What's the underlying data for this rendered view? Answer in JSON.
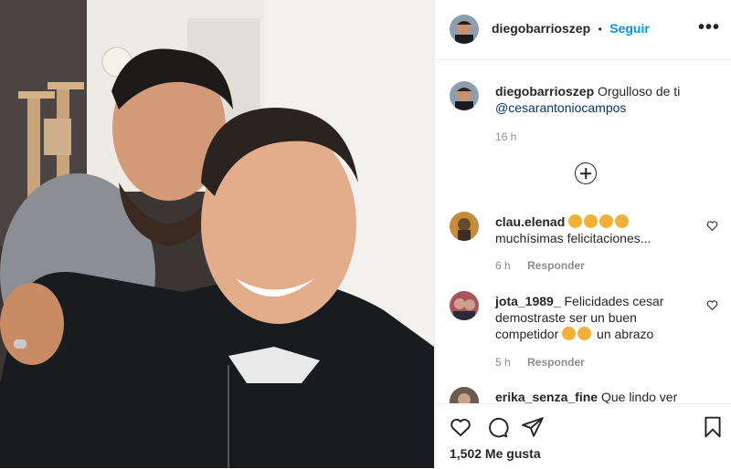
{
  "post": {
    "username": "diegobarrioszep",
    "follow_label": "Seguir",
    "dot": "•",
    "more": "•••"
  },
  "caption": {
    "username": "diegobarrioszep",
    "text": "Orgulloso de ti",
    "mention": "@cesarantoniocampos",
    "time": "16 h"
  },
  "comments": [
    {
      "username": "clau.elenad",
      "text": "muchísimas felicitaciones...",
      "time": "6 h",
      "reply": "Responder"
    },
    {
      "username": "jota_1989_",
      "text1": "Felicidades cesar",
      "text2": "demostraste ser un buen",
      "text3a": "competidor",
      "text3b": "un abrazo",
      "time": "5 h",
      "reply": "Responder"
    },
    {
      "username": "erika_senza_fine",
      "text": "Que lindo ver"
    }
  ],
  "likes": "1,502 Me gusta",
  "colors": {
    "link": "#0095f6",
    "mention": "#00376b",
    "muted": "#8e8e8e"
  }
}
